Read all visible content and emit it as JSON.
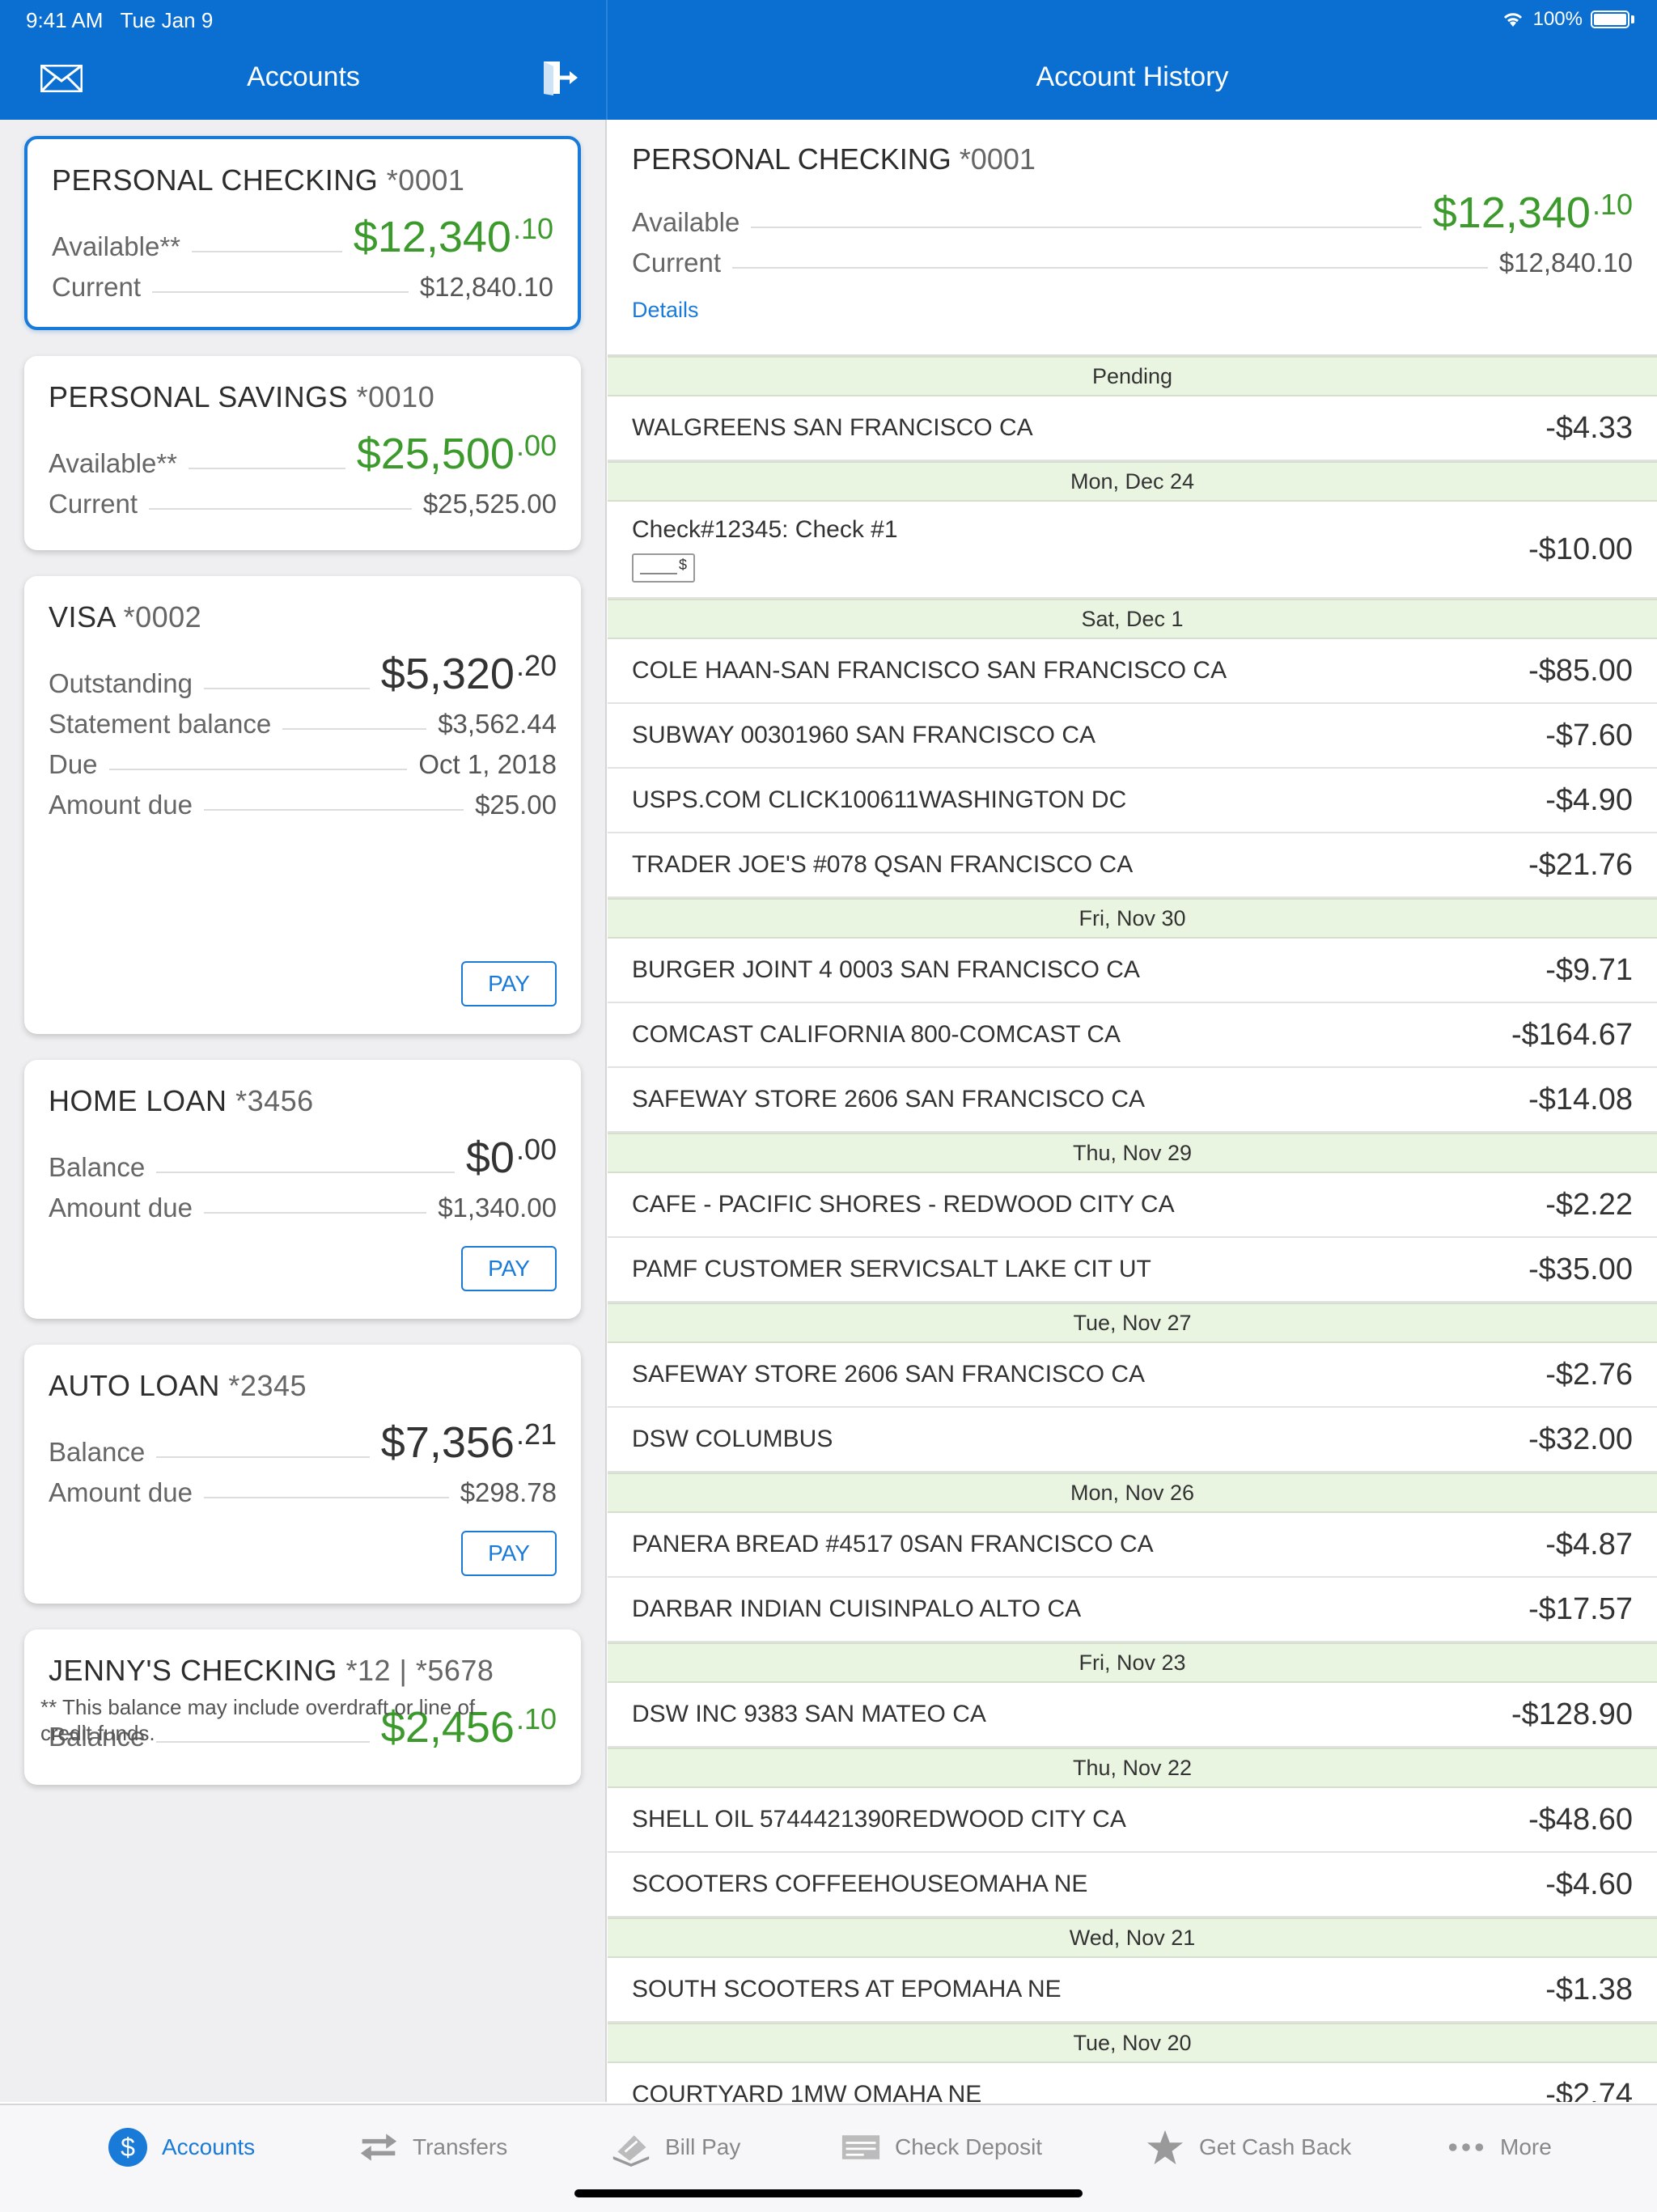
{
  "status": {
    "time": "9:41 AM",
    "date": "Tue Jan 9",
    "battery": "100%"
  },
  "header": {
    "left_title": "Accounts",
    "right_title": "Account History"
  },
  "accounts": [
    {
      "name": "PERSONAL CHECKING",
      "number": "*0001",
      "rows": [
        {
          "label": "Available**",
          "big_main": "$12,340",
          "big_cents": ".10",
          "color": "green"
        },
        {
          "label": "Current",
          "value": "$12,840.10"
        }
      ]
    },
    {
      "name": "PERSONAL SAVINGS",
      "number": "*0010",
      "rows": [
        {
          "label": "Available**",
          "big_main": "$25,500",
          "big_cents": ".00",
          "color": "green"
        },
        {
          "label": "Current",
          "value": "$25,525.00"
        }
      ]
    },
    {
      "name": "VISA",
      "number": "*0002",
      "rows": [
        {
          "label": "Outstanding",
          "big_main": "$5,320",
          "big_cents": ".20",
          "color": "dark"
        },
        {
          "label": "Statement balance",
          "value": "$3,562.44"
        },
        {
          "label": "Due",
          "value": "Oct 1, 2018"
        },
        {
          "label": "Amount due",
          "value": "$25.00"
        }
      ],
      "pay": "PAY"
    },
    {
      "name": "HOME LOAN",
      "number": "*3456",
      "rows": [
        {
          "label": "Balance",
          "big_main": "$0",
          "big_cents": ".00",
          "color": "dark"
        },
        {
          "label": "Amount due",
          "value": "$1,340.00"
        }
      ],
      "pay": "PAY"
    },
    {
      "name": "AUTO LOAN",
      "number": "*2345",
      "rows": [
        {
          "label": "Balance",
          "big_main": "$7,356",
          "big_cents": ".21",
          "color": "dark"
        },
        {
          "label": "Amount due",
          "value": "$298.78"
        }
      ],
      "pay": "PAY"
    },
    {
      "name": "JENNY'S CHECKING",
      "number": "*12 | *5678",
      "rows": [
        {
          "label": "Balance",
          "big_main": "$2,456",
          "big_cents": ".10",
          "color": "green"
        }
      ]
    }
  ],
  "footnote": "** This balance may include overdraft or line of credit funds.",
  "history": {
    "account_name": "PERSONAL CHECKING",
    "account_number": "*0001",
    "available_label": "Available",
    "available_main": "$12,340",
    "available_cents": ".10",
    "current_label": "Current",
    "current_value": "$12,840.10",
    "details": "Details",
    "groups": [
      {
        "date": "Pending",
        "items": [
          {
            "desc": "WALGREENS SAN FRANCISCO CA",
            "amount": "-$4.33"
          }
        ]
      },
      {
        "date": "Mon, Dec 24",
        "items": [
          {
            "desc": "Check#12345: Check #1",
            "amount": "-$10.00",
            "check": true
          }
        ]
      },
      {
        "date": "Sat, Dec 1",
        "items": [
          {
            "desc": "COLE HAAN-SAN FRANCISCO SAN FRANCISCO CA",
            "amount": "-$85.00"
          },
          {
            "desc": "SUBWAY 00301960 SAN FRANCISCO CA",
            "amount": "-$7.60"
          },
          {
            "desc": "USPS.COM CLICK100611WASHINGTON DC",
            "amount": "-$4.90"
          },
          {
            "desc": "TRADER JOE'S #078 QSAN FRANCISCO CA",
            "amount": "-$21.76"
          }
        ]
      },
      {
        "date": "Fri, Nov 30",
        "items": [
          {
            "desc": "BURGER JOINT 4 0003 SAN FRANCISCO CA",
            "amount": "-$9.71"
          },
          {
            "desc": "COMCAST CALIFORNIA 800-COMCAST CA",
            "amount": "-$164.67"
          },
          {
            "desc": "SAFEWAY STORE 2606 SAN FRANCISCO CA",
            "amount": "-$14.08"
          }
        ]
      },
      {
        "date": "Thu, Nov 29",
        "items": [
          {
            "desc": "CAFE - PACIFIC SHORES - REDWOOD CITY CA",
            "amount": "-$2.22"
          },
          {
            "desc": "PAMF CUSTOMER SERVICSALT LAKE CIT UT",
            "amount": "-$35.00"
          }
        ]
      },
      {
        "date": "Tue, Nov 27",
        "items": [
          {
            "desc": "SAFEWAY STORE 2606 SAN FRANCISCO CA",
            "amount": "-$2.76"
          },
          {
            "desc": "DSW COLUMBUS",
            "amount": "-$32.00"
          }
        ]
      },
      {
        "date": "Mon, Nov 26",
        "items": [
          {
            "desc": "PANERA BREAD #4517 0SAN FRANCISCO CA",
            "amount": "-$4.87"
          },
          {
            "desc": "DARBAR INDIAN CUISINPALO ALTO CA",
            "amount": "-$17.57"
          }
        ]
      },
      {
        "date": "Fri, Nov 23",
        "items": [
          {
            "desc": "DSW INC 9383 SAN MATEO CA",
            "amount": "-$128.90"
          }
        ]
      },
      {
        "date": "Thu, Nov 22",
        "items": [
          {
            "desc": "SHELL OIL 5744421390REDWOOD CITY CA",
            "amount": "-$48.60"
          },
          {
            "desc": "SCOOTERS COFFEEHOUSEOMAHA NE",
            "amount": "-$4.60"
          }
        ]
      },
      {
        "date": "Wed, Nov 21",
        "items": [
          {
            "desc": "SOUTH SCOOTERS AT EPOMAHA NE",
            "amount": "-$1.38"
          }
        ]
      },
      {
        "date": "Tue, Nov 20",
        "items": [
          {
            "desc": "COURTYARD 1MW OMAHA NE",
            "amount": "-$2.74"
          }
        ]
      }
    ]
  },
  "tabs": [
    {
      "label": "Accounts",
      "icon": "dollar-icon",
      "active": true
    },
    {
      "label": "Transfers",
      "icon": "transfer-icon"
    },
    {
      "label": "Bill Pay",
      "icon": "bill-pay-icon"
    },
    {
      "label": "Check Deposit",
      "icon": "check-deposit-icon"
    },
    {
      "label": "Get Cash Back",
      "icon": "star-icon"
    },
    {
      "label": "More",
      "icon": "more-icon"
    }
  ],
  "colors": {
    "brand": "#0a6fd0",
    "positive": "#3c9a2c",
    "date_band": "#eaf5e1"
  }
}
